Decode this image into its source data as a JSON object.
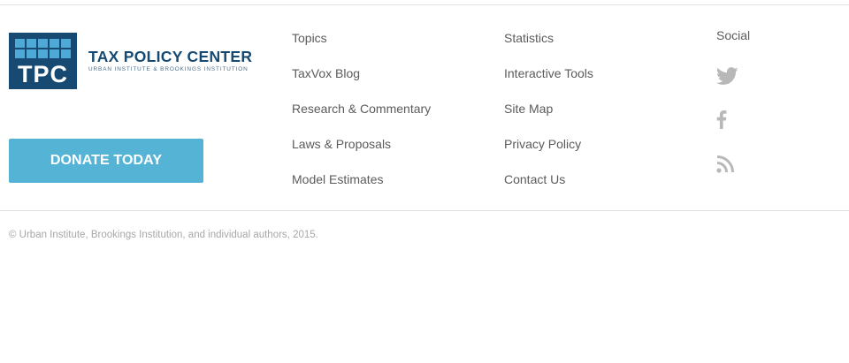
{
  "logo": {
    "mark_text": "TPC",
    "title": "TAX POLICY CENTER",
    "subtitle": "URBAN INSTITUTE & BROOKINGS INSTITUTION",
    "colors": {
      "navy": "#164a72",
      "tile": "#4fa9d6"
    }
  },
  "donate": {
    "label": "DONATE TODAY",
    "color": "#55b3d5"
  },
  "nav": {
    "col1": [
      "Topics",
      "TaxVox Blog",
      "Research & Commentary",
      "Laws & Proposals",
      "Model Estimates"
    ],
    "col2": [
      "Statistics",
      "Interactive Tools",
      "Site Map",
      "Privacy Policy",
      "Contact Us"
    ]
  },
  "social": {
    "label": "Social",
    "icons": [
      "twitter-icon",
      "facebook-icon",
      "rss-icon"
    ]
  },
  "footer": {
    "copyright": "© Urban Institute, Brookings Institution, and individual authors, 2015."
  }
}
